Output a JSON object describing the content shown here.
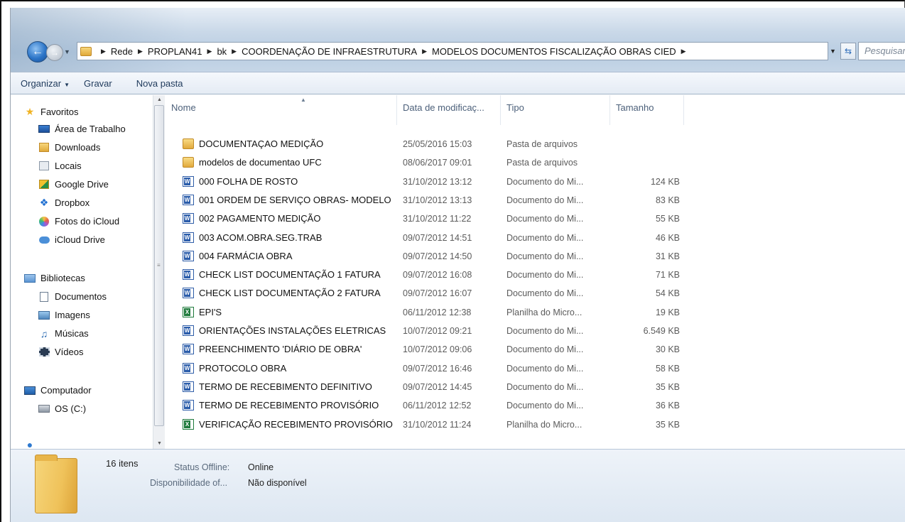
{
  "address": {
    "crumbs": [
      "Rede",
      "PROPLAN41",
      "bk",
      "COORDENAÇÃO DE INFRAESTRUTURA",
      "MODELOS DOCUMENTOS FISCALIZAÇÃO OBRAS CIED"
    ],
    "search_placeholder": "Pesquisar"
  },
  "toolbar": {
    "organize_label": "Organizar",
    "burn_label": "Gravar",
    "new_folder_label": "Nova pasta"
  },
  "nav": {
    "favorites_label": "Favoritos",
    "favorites": [
      "Área de Trabalho",
      "Downloads",
      "Locais",
      "Google Drive",
      "Dropbox",
      "Fotos do iCloud",
      "iCloud Drive"
    ],
    "libraries_label": "Bibliotecas",
    "libraries": [
      "Documentos",
      "Imagens",
      "Músicas",
      "Vídeos"
    ],
    "computer_label": "Computador",
    "drives": [
      "OS (C:)"
    ]
  },
  "columns": {
    "name": "Nome",
    "date": "Data de modificaç...",
    "type": "Tipo",
    "size": "Tamanho"
  },
  "files": [
    {
      "name": "DOCUMENTAÇAO MEDIÇÃO",
      "date": "25/05/2016 15:03",
      "type": "Pasta de arquivos",
      "size": "",
      "icon": "folder-icon"
    },
    {
      "name": "modelos de documentao UFC",
      "date": "08/06/2017 09:01",
      "type": "Pasta de arquivos",
      "size": "",
      "icon": "folder-icon"
    },
    {
      "name": "000 FOLHA DE ROSTO",
      "date": "31/10/2012 13:12",
      "type": "Documento do Mi...",
      "size": "124 KB",
      "icon": "word-icon"
    },
    {
      "name": "001 ORDEM DE SERVIÇO OBRAS- MODELO",
      "date": "31/10/2012 13:13",
      "type": "Documento do Mi...",
      "size": "83 KB",
      "icon": "word-icon"
    },
    {
      "name": "002 PAGAMENTO MEDIÇÃO",
      "date": "31/10/2012 11:22",
      "type": "Documento do Mi...",
      "size": "55 KB",
      "icon": "word-icon"
    },
    {
      "name": "003 ACOM.OBRA.SEG.TRAB",
      "date": "09/07/2012 14:51",
      "type": "Documento do Mi...",
      "size": "46 KB",
      "icon": "word-icon"
    },
    {
      "name": "004 FARMÁCIA OBRA",
      "date": "09/07/2012 14:50",
      "type": "Documento do Mi...",
      "size": "31 KB",
      "icon": "word-icon"
    },
    {
      "name": "CHECK LIST DOCUMENTAÇÃO  1 FATURA",
      "date": "09/07/2012 16:08",
      "type": "Documento do Mi...",
      "size": "71 KB",
      "icon": "word-icon"
    },
    {
      "name": "CHECK LIST DOCUMENTAÇÃO  2 FATURA",
      "date": "09/07/2012 16:07",
      "type": "Documento do Mi...",
      "size": "54 KB",
      "icon": "word-icon"
    },
    {
      "name": "EPI'S",
      "date": "06/11/2012 12:38",
      "type": "Planilha do Micro...",
      "size": "19 KB",
      "icon": "excel-icon"
    },
    {
      "name": "ORIENTAÇÕES INSTALAÇÕES ELETRICAS",
      "date": "10/07/2012 09:21",
      "type": "Documento do Mi...",
      "size": "6.549 KB",
      "icon": "word-icon"
    },
    {
      "name": "PREENCHIMENTO 'DIÁRIO DE OBRA'",
      "date": "10/07/2012 09:06",
      "type": "Documento do Mi...",
      "size": "30 KB",
      "icon": "word-icon"
    },
    {
      "name": "PROTOCOLO OBRA",
      "date": "09/07/2012 16:46",
      "type": "Documento do Mi...",
      "size": "58 KB",
      "icon": "word-icon"
    },
    {
      "name": "TERMO DE RECEBIMENTO DEFINITIVO",
      "date": "09/07/2012 14:45",
      "type": "Documento do Mi...",
      "size": "35 KB",
      "icon": "word-icon"
    },
    {
      "name": "TERMO DE RECEBIMENTO PROVISÓRIO",
      "date": "06/11/2012 12:52",
      "type": "Documento do Mi...",
      "size": "36 KB",
      "icon": "word-icon"
    },
    {
      "name": "VERIFICAÇÃO RECEBIMENTO PROVISÓRIO",
      "date": "31/10/2012 11:24",
      "type": "Planilha do Micro...",
      "size": "35 KB",
      "icon": "excel-icon"
    }
  ],
  "details": {
    "count": "16 itens",
    "status_label": "Status Offline:",
    "status_value": "Online",
    "availability_label": "Disponibilidade of...",
    "availability_value": "Não disponível"
  }
}
